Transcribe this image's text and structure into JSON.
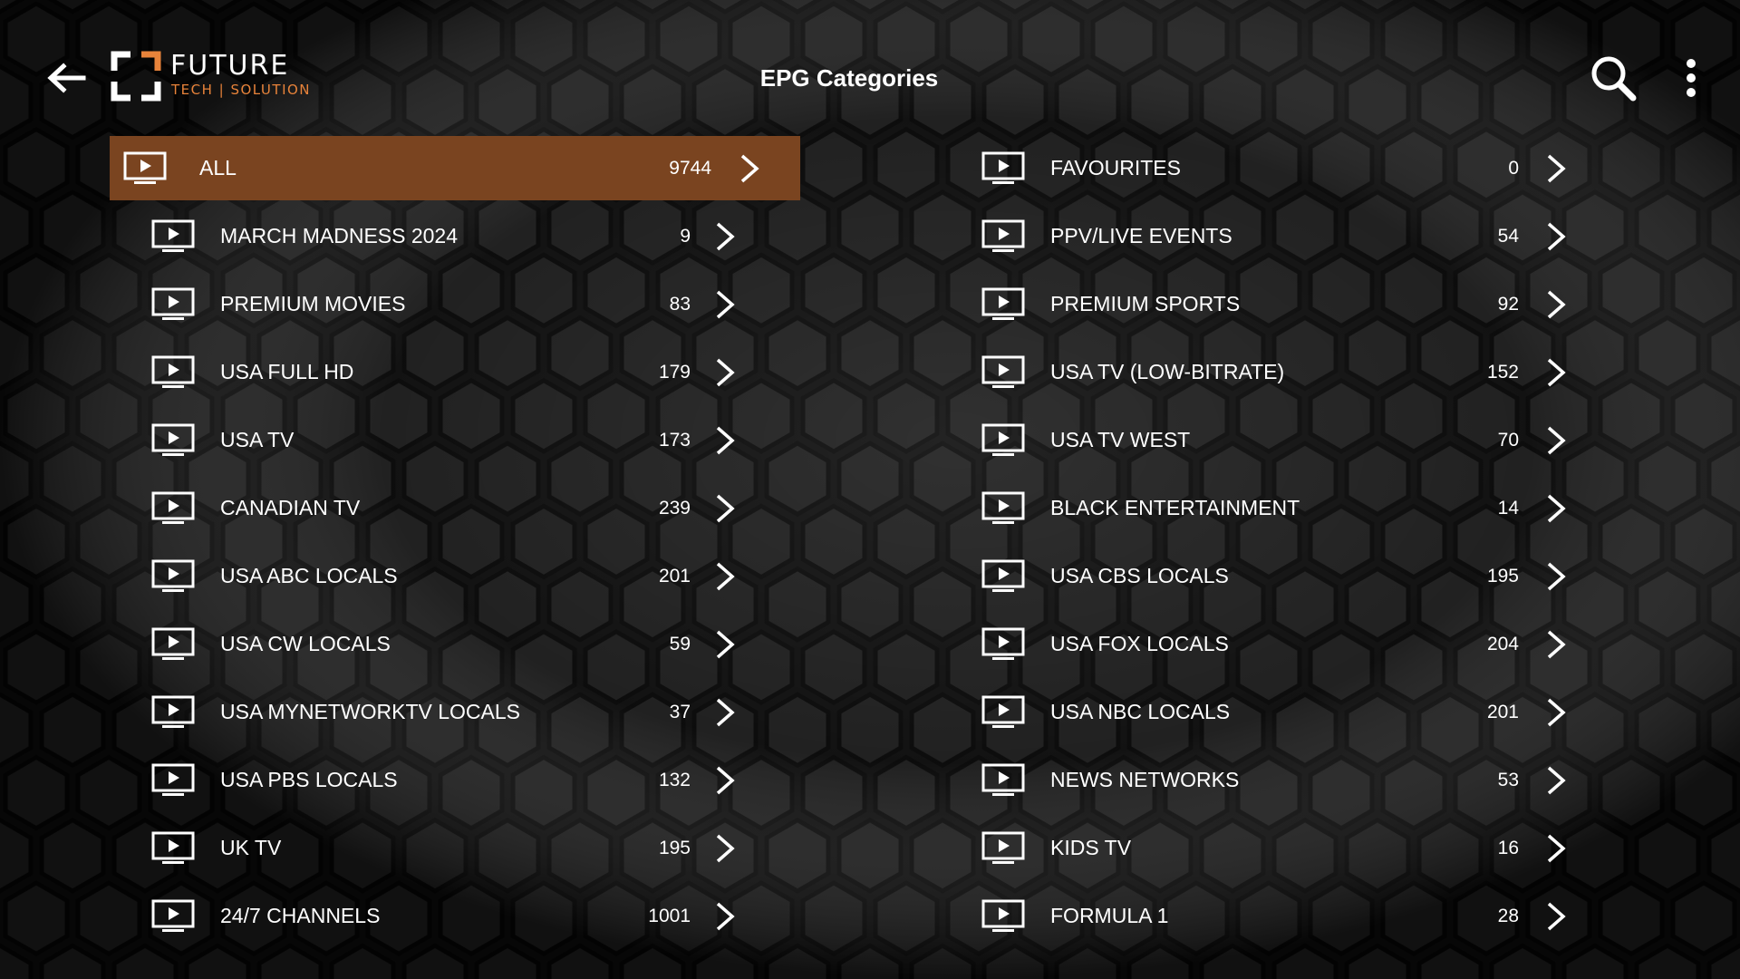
{
  "header": {
    "title": "EPG Categories",
    "logo_title": "FUTURE",
    "logo_subtitle": "TECH | SOLUTION",
    "back_icon": "arrow-left-icon",
    "search_icon": "search-icon",
    "menu_icon": "more-vertical-icon"
  },
  "colors": {
    "background": "#0b0b0b",
    "selected_row": "#7a4420",
    "accent": "#e8833a",
    "text": "#ffffff"
  },
  "categories_left": [
    {
      "label": "ALL",
      "count": "9744",
      "selected": true
    },
    {
      "label": "MARCH MADNESS 2024",
      "count": "9"
    },
    {
      "label": "PREMIUM MOVIES",
      "count": "83"
    },
    {
      "label": "USA FULL HD",
      "count": "179"
    },
    {
      "label": "USA TV",
      "count": "173"
    },
    {
      "label": "CANADIAN TV",
      "count": "239"
    },
    {
      "label": "USA ABC LOCALS",
      "count": "201"
    },
    {
      "label": "USA CW LOCALS",
      "count": "59"
    },
    {
      "label": "USA MYNETWORKTV LOCALS",
      "count": "37"
    },
    {
      "label": "USA PBS LOCALS",
      "count": "132"
    },
    {
      "label": "UK TV",
      "count": "195"
    },
    {
      "label": "24/7 CHANNELS",
      "count": "1001"
    }
  ],
  "categories_right": [
    {
      "label": "FAVOURITES",
      "count": "0"
    },
    {
      "label": "PPV/LIVE EVENTS",
      "count": "54"
    },
    {
      "label": "PREMIUM SPORTS",
      "count": "92"
    },
    {
      "label": "USA TV (LOW-BITRATE)",
      "count": "152"
    },
    {
      "label": "USA TV WEST",
      "count": "70"
    },
    {
      "label": "BLACK ENTERTAINMENT",
      "count": "14"
    },
    {
      "label": "USA CBS LOCALS",
      "count": "195"
    },
    {
      "label": "USA FOX LOCALS",
      "count": "204"
    },
    {
      "label": "USA NBC LOCALS",
      "count": "201"
    },
    {
      "label": "NEWS NETWORKS",
      "count": "53"
    },
    {
      "label": "KIDS TV",
      "count": "16"
    },
    {
      "label": "FORMULA 1",
      "count": "28"
    }
  ]
}
